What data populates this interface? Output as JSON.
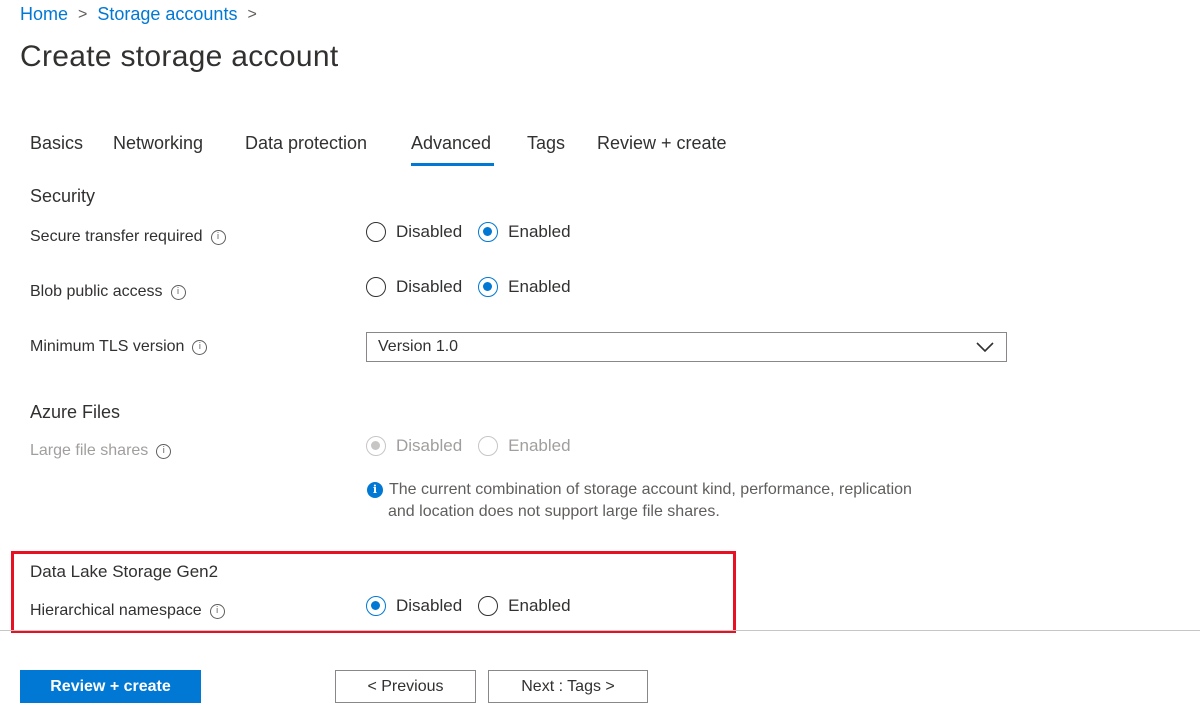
{
  "breadcrumb": {
    "items": [
      "Home",
      "Storage accounts"
    ],
    "separator": ">"
  },
  "page_title": "Create storage account",
  "tabs": [
    {
      "label": "Basics",
      "active": false
    },
    {
      "label": "Networking",
      "active": false
    },
    {
      "label": "Data protection",
      "active": false
    },
    {
      "label": "Advanced",
      "active": true
    },
    {
      "label": "Tags",
      "active": false
    },
    {
      "label": "Review + create",
      "active": false
    }
  ],
  "security": {
    "heading": "Security",
    "secure_transfer": {
      "label": "Secure transfer required",
      "options": [
        "Disabled",
        "Enabled"
      ],
      "selected": "Enabled"
    },
    "blob_public_access": {
      "label": "Blob public access",
      "options": [
        "Disabled",
        "Enabled"
      ],
      "selected": "Enabled"
    },
    "min_tls": {
      "label": "Minimum TLS version",
      "value": "Version 1.0"
    }
  },
  "azure_files": {
    "heading": "Azure Files",
    "large_file_shares": {
      "label": "Large file shares",
      "options": [
        "Disabled",
        "Enabled"
      ],
      "selected": "Disabled",
      "disabled": true
    },
    "note_line1": "The current combination of storage account kind, performance, replication",
    "note_line2": "and location does not support large file shares."
  },
  "data_lake": {
    "heading": "Data Lake Storage Gen2",
    "hierarchical_namespace": {
      "label": "Hierarchical namespace",
      "options": [
        "Disabled",
        "Enabled"
      ],
      "selected": "Disabled"
    }
  },
  "footer": {
    "review_create": "Review + create",
    "previous": "< Previous",
    "next": "Next : Tags >"
  },
  "colors": {
    "accent": "#0078d4",
    "highlight_border": "#e81123"
  },
  "icons": {
    "info": "info-icon",
    "note": "info-filled-icon",
    "dropdown": "chevron-down-icon"
  }
}
